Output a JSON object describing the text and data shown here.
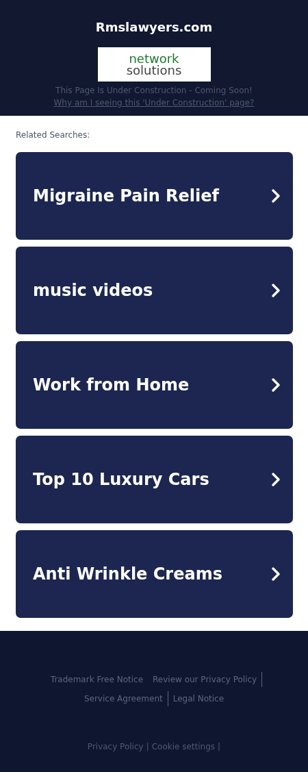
{
  "header": {
    "title": "Rmslawyers.com",
    "logo": {
      "line_1": "network",
      "line_2": "solutions"
    },
    "notice": "This Page Is Under Construction - Coming Soon!",
    "why_link": "Why am I seeing this 'Under Construction' page?"
  },
  "related": {
    "heading": "Related Searches:",
    "items": [
      {
        "label": "Migraine Pain Relief"
      },
      {
        "label": "music videos"
      },
      {
        "label": "Work from Home"
      },
      {
        "label": "Top 10 Luxury Cars"
      },
      {
        "label": "Anti Wrinkle Creams"
      }
    ]
  },
  "footer": {
    "links": [
      {
        "label": "Trademark Free Notice",
        "divider_after": false
      },
      {
        "label": "Review our Privacy Policy",
        "divider_after": true
      },
      {
        "label": "Service Agreement",
        "divider_after": true
      },
      {
        "label": "Legal Notice",
        "divider_after": false
      }
    ],
    "bottom_links": [
      {
        "label": "Privacy Policy",
        "separator": "|"
      },
      {
        "label": "Cookie settings",
        "separator": "|"
      }
    ]
  }
}
